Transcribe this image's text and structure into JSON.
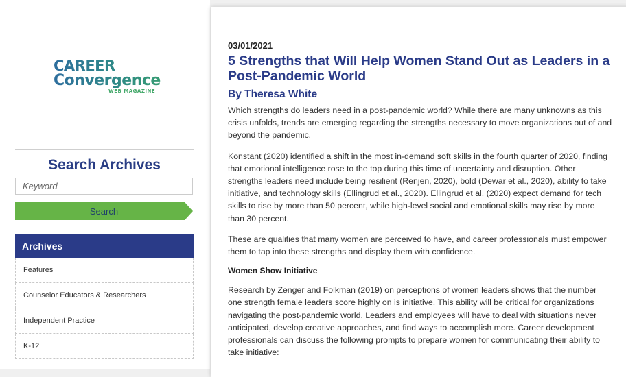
{
  "logo": {
    "line1": "CAREER",
    "line2": "Convergence",
    "sub": "WEB MAGAZINE"
  },
  "sidebar": {
    "search_title": "Search Archives",
    "search_placeholder": "Keyword",
    "search_button": "Search",
    "archives_title": "Archives",
    "archives": [
      {
        "label": "Features"
      },
      {
        "label": "Counselor Educators & Researchers"
      },
      {
        "label": "Independent Practice"
      },
      {
        "label": "K-12"
      }
    ]
  },
  "article": {
    "date": "03/01/2021",
    "title": "5 Strengths that Will Help Women Stand Out as Leaders in a Post-Pandemic World",
    "byline": "By Theresa White",
    "paragraphs": [
      "Which strengths do leaders need in a post-pandemic world? While there are many unknowns as this crisis unfolds, trends are emerging regarding the strengths necessary to move organizations out of and beyond the pandemic.",
      "Konstant (2020) identified a shift in the most in-demand soft skills in the fourth quarter of 2020, finding that emotional intelligence rose to the top during this time of uncertainty and disruption. Other strengths leaders need include being resilient (Renjen, 2020), bold (Dewar et al., 2020), ability to take initiative, and technology skills (Ellingrud et al., 2020). Ellingrud et al. (2020) expect demand for tech skills to rise by more than 50 percent, while high-level social and emotional skills may rise by more than 30 percent.",
      "These are qualities that many women are perceived to have, and career professionals must empower them to tap into these strengths and display them with confidence."
    ],
    "subheading": "Women Show Initiative",
    "paragraph_after": "Research by Zenger and Folkman (2019) on perceptions of women leaders shows that the number one strength female leaders score highly on is initiative. This ability will be critical for organizations navigating the post-pandemic world. Leaders and employees will have to deal with situations never anticipated, develop creative approaches, and find ways to accomplish more. Career development professionals can discuss the following prompts to prepare women for communicating their ability to take initiative:"
  },
  "colors": {
    "brand_navy": "#2a3b88",
    "accent_green": "#66b447"
  }
}
